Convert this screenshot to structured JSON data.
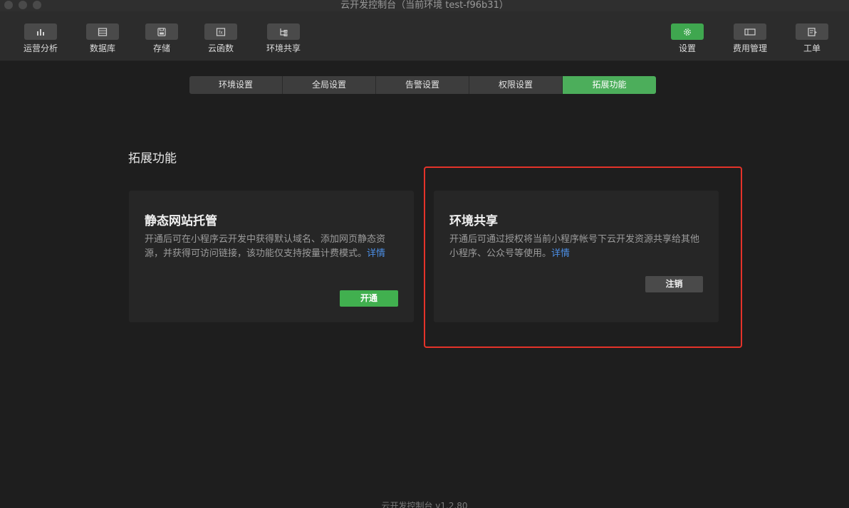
{
  "window": {
    "title": "云开发控制台（当前环境 test-f96b31）"
  },
  "toolbar": {
    "left": [
      {
        "label": "运营分析",
        "icon": "bar-chart-icon"
      },
      {
        "label": "数据库",
        "icon": "database-icon"
      },
      {
        "label": "存储",
        "icon": "storage-icon"
      },
      {
        "label": "云函数",
        "icon": "function-icon"
      },
      {
        "label": "环境共享",
        "icon": "share-tree-icon"
      }
    ],
    "right": [
      {
        "label": "设置",
        "icon": "gear-icon",
        "active": true
      },
      {
        "label": "费用管理",
        "icon": "billing-icon"
      },
      {
        "label": "工单",
        "icon": "ticket-icon"
      }
    ]
  },
  "tabs": [
    {
      "label": "环境设置"
    },
    {
      "label": "全局设置"
    },
    {
      "label": "告警设置"
    },
    {
      "label": "权限设置"
    },
    {
      "label": "拓展功能",
      "active": true
    }
  ],
  "section": {
    "title": "拓展功能"
  },
  "cards": {
    "static_hosting": {
      "title": "静态网站托管",
      "desc": "开通后可在小程序云开发中获得默认域名、添加网页静态资源，并获得可访问链接，该功能仅支持按量计费模式。",
      "link": "详情",
      "button": "开通"
    },
    "env_share": {
      "title": "环境共享",
      "desc": "开通后可通过授权将当前小程序帐号下云开发资源共享给其他小程序、公众号等使用。",
      "link": "详情",
      "button": "注销"
    }
  },
  "footer": {
    "version": "云开发控制台 v1.2.80"
  },
  "colors": {
    "accent_green": "#41b04f",
    "link_blue": "#4c8fe6",
    "highlight_red": "#e5332a"
  }
}
